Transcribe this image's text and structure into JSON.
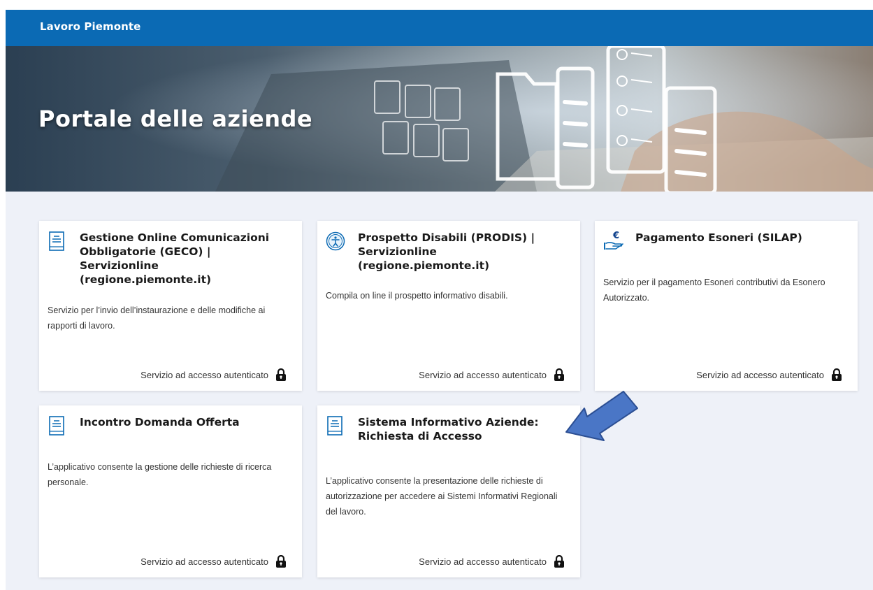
{
  "header": {
    "brand": "Lavoro Piemonte"
  },
  "hero": {
    "title": "Portale delle aziende"
  },
  "cards": [
    {
      "icon": "document-icon",
      "title": "Gestione Online Comunicazioni Obbligatorie (GECO) | Servizionline (regione.piemonte.it)",
      "description": "Servizio per l’invio dell’instaurazione e delle modifiche ai rapporti di lavoro.",
      "footer": "Servizio ad accesso autenticato"
    },
    {
      "icon": "accessibility-icon",
      "title": "Prospetto Disabili (PRODIS) | Servizionline (regione.piemonte.it)",
      "description": "Compila on line il prospetto informativo disabili.",
      "footer": "Servizio ad accesso autenticato"
    },
    {
      "icon": "euro-payment-icon",
      "title": "Pagamento Esoneri (SILAP)",
      "description": "Servizio per il pagamento Esoneri contributivi da Esonero Autorizzato.",
      "footer": "Servizio ad accesso autenticato"
    },
    {
      "icon": "document-icon",
      "title": "Incontro Domanda Offerta",
      "description": "L’applicativo consente la gestione delle richieste di ricerca personale.",
      "footer": "Servizio ad accesso autenticato"
    },
    {
      "icon": "document-icon",
      "title": "Sistema Informativo Aziende: Richiesta di Accesso",
      "description": "L’applicativo consente la presentazione delle richieste di autorizzazione per accedere ai Sistemi Informativi Regionali del lavoro.",
      "footer": "Servizio ad accesso autenticato"
    }
  ],
  "colors": {
    "header": "#0b6ab4",
    "background": "#eef1f8",
    "arrow": "#4a76c6"
  }
}
